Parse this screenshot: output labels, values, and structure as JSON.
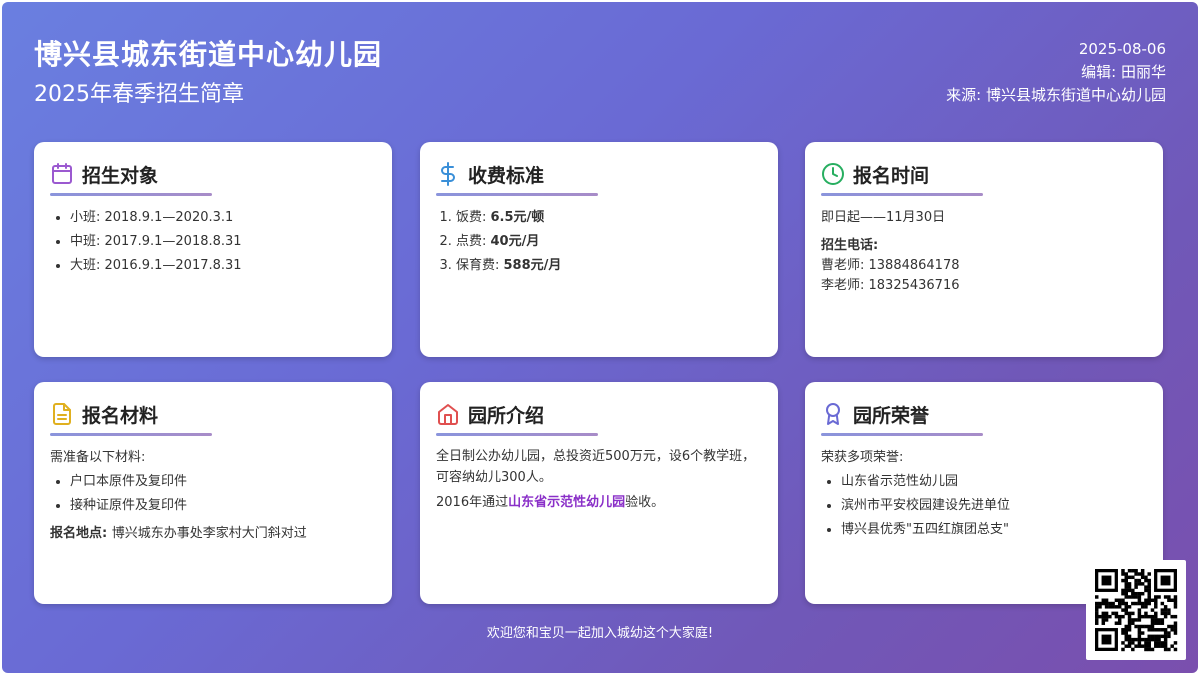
{
  "header": {
    "title": "博兴县城东街道中心幼儿园",
    "subtitle": "2025年春季招生简章",
    "date": "2025-08-06",
    "editor": "编辑: 田丽华",
    "source": "来源: 博兴县城东街道中心幼儿园"
  },
  "colors": {
    "accent": "#8a2fc8",
    "calendar": "#9b59d0",
    "dollar": "#3a8fd8",
    "clock": "#27ae60",
    "doc": "#e0b020",
    "home": "#e05050",
    "award": "#6a6ad4"
  },
  "cards": {
    "target": {
      "icon": "calendar-icon",
      "title": "招生对象",
      "items": [
        "小班: 2018.9.1—2020.3.1",
        "中班: 2017.9.1—2018.8.31",
        "大班: 2016.9.1—2017.8.31"
      ]
    },
    "fees": {
      "icon": "dollar-icon",
      "title": "收费标准",
      "items": [
        {
          "label": "饭费: ",
          "value": "6.5元/顿"
        },
        {
          "label": "点费: ",
          "value": "40元/月"
        },
        {
          "label": "保育费: ",
          "value": "588元/月"
        }
      ]
    },
    "time": {
      "icon": "clock-icon",
      "title": "报名时间",
      "period": "即日起——11月30日",
      "phone_label": "招生电话:",
      "contacts": [
        "曹老师: 13884864178",
        "李老师: 18325436716"
      ]
    },
    "materials": {
      "icon": "document-icon",
      "title": "报名材料",
      "intro": "需准备以下材料:",
      "items": [
        "户口本原件及复印件",
        "接种证原件及复印件"
      ],
      "location_label": "报名地点: ",
      "location": "博兴城东办事处李家村大门斜对过"
    },
    "intro": {
      "icon": "home-icon",
      "title": "园所介绍",
      "text1": "全日制公办幼儿园，总投资近500万元，设6个教学班，可容纳幼儿300人。",
      "text2_pre": "2016年通过",
      "text2_highlight": "山东省示范性幼儿园",
      "text2_post": "验收。"
    },
    "honors": {
      "icon": "award-icon",
      "title": "园所荣誉",
      "intro": "荣获多项荣誉:",
      "items": [
        "山东省示范性幼儿园",
        "滨州市平安校园建设先进单位",
        "博兴县优秀\"五四红旗团总支\""
      ]
    }
  },
  "footer": {
    "text": "欢迎您和宝贝一起加入城幼这个大家庭!"
  }
}
